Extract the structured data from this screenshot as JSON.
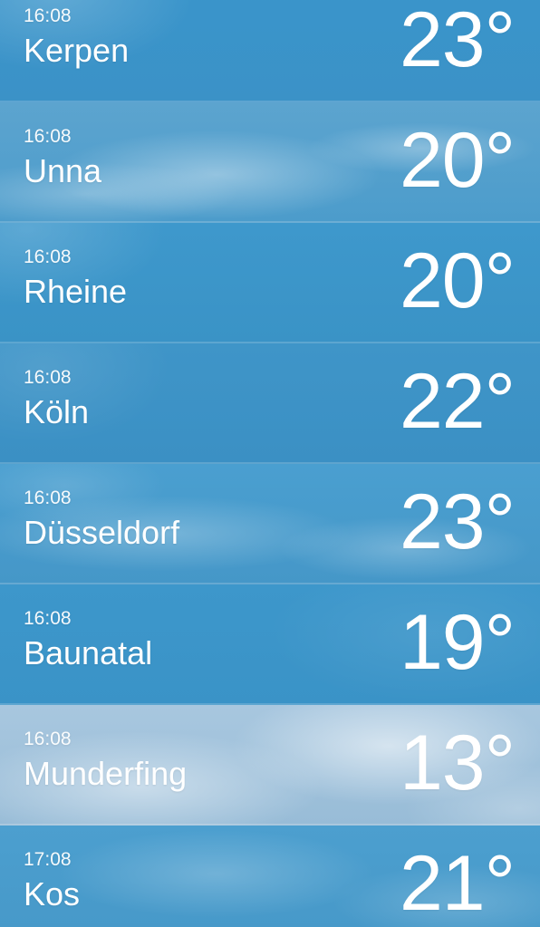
{
  "locations": [
    {
      "time": "16:08",
      "city": "Kerpen",
      "temperature": "23°"
    },
    {
      "time": "16:08",
      "city": "Unna",
      "temperature": "20°"
    },
    {
      "time": "16:08",
      "city": "Rheine",
      "temperature": "20°"
    },
    {
      "time": "16:08",
      "city": "Köln",
      "temperature": "22°"
    },
    {
      "time": "16:08",
      "city": "Düsseldorf",
      "temperature": "23°"
    },
    {
      "time": "16:08",
      "city": "Baunatal",
      "temperature": "19°"
    },
    {
      "time": "16:08",
      "city": "Munderfing",
      "temperature": "13°"
    },
    {
      "time": "17:08",
      "city": "Kos",
      "temperature": "21°"
    }
  ]
}
